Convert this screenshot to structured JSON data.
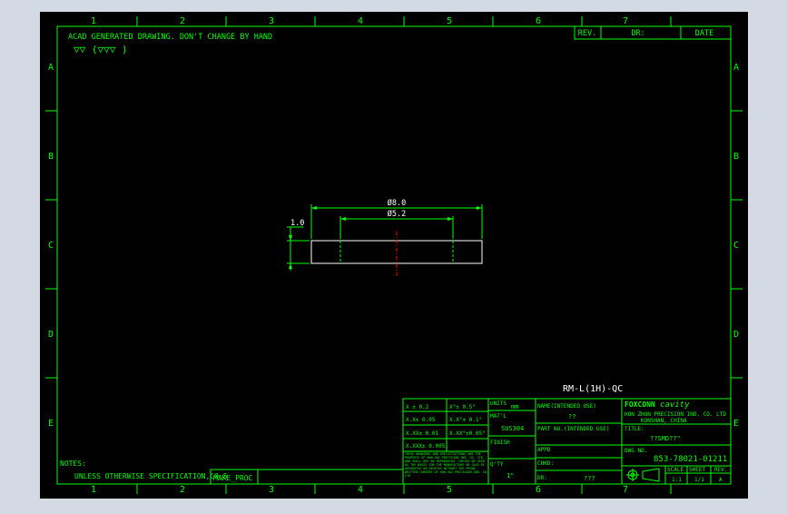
{
  "drawing": {
    "header_note": "ACAD GENERATED DRAWING. DON'T CHANGE BY HAND",
    "surface_symbols": "▽▽ (▽▽▽    )",
    "revision_block": {
      "rev": "REV.",
      "dr": "DR:",
      "date": "DATE"
    },
    "grid_columns": [
      "1",
      "2",
      "3",
      "4",
      "5",
      "6",
      "7"
    ],
    "grid_rows": [
      "A",
      "B",
      "C",
      "D",
      "E"
    ],
    "dimensions": {
      "outer_diameter": "Ø8.0",
      "inner_diameter": "Ø5.2",
      "thickness": "1.0"
    },
    "part_number_label": "RM-L(1H)-QC",
    "notes_label": "NOTES:",
    "notes_text": "UNLESS OTHERWISE SPECIFICATION,C0.5",
    "make_proc": "MAKE_PROC"
  },
  "title_block": {
    "tolerances": [
      "X ± 0.2",
      "X.X± 0.05",
      "X.XX± 0.01",
      "X.XXX± 0.005"
    ],
    "angle_tolerances": [
      "X°± 0.5°",
      "X.X°± 0.1°",
      "X.XX°±0.05°"
    ],
    "confidentiality": "THESE DRAWINGS AND SPECIFICATIONS ARE THE PROPERTY OF HON HAI PRECISION IND. CO. LTD AND SHALL NOT BE REPRODUCED, COPIED OR USED AS THE BASIS FOR THE MANUFACTURE OR SALE OF APPARATUS OR DEVICES WITHOUT THE PRIOR WRITTEN CONSENT OF HON HAI PRECISION IND. CO. LTD",
    "units_label": "UNITS",
    "units_value": "mm",
    "matl_label": "MAT'L",
    "matl_value": "SUS304",
    "finish_label": "FINISH",
    "qty_label": "Q'TY",
    "qty_value": "1\"",
    "name_label": "NAME(INTENDED USE)",
    "name_value": "??",
    "part_no_label": "PART NO.(INTENDED USE)",
    "appd_label": "APPD",
    "chkd_label": "CHKD:",
    "dr_label": "DR:",
    "dr_value": "???",
    "company_logo": "FOXCONN",
    "company_logo_suffix": "cavity",
    "company_name": "HON ZHUN PRECISION IND. CO. LTD",
    "company_location": "KUNSHAN, CHINA",
    "title_label": "TITLE:",
    "title_value": "??SMD??\"",
    "dwg_no_label": "DWG NO.",
    "dwg_no_value": "853-78021-01211",
    "scale_label": "SCALE",
    "scale_value": "1:1",
    "sheet_label": "SHEET",
    "sheet_value": "1/1",
    "rev_label": "REV.",
    "rev_value": "A"
  },
  "colors": {
    "background": "#000000",
    "frame": "#00ff00",
    "part_outline": "#ffffff",
    "centerline": "#ff0000",
    "text": "#00ff00",
    "outer_bg": "#d3dae3"
  }
}
